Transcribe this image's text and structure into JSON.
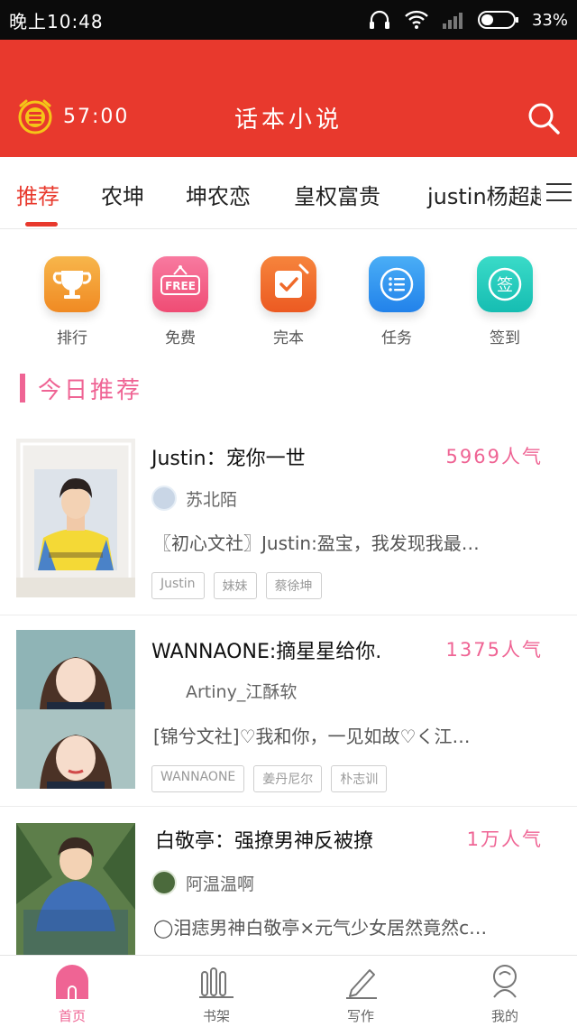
{
  "status_bar": {
    "time": "晚上10:48",
    "battery": "33%"
  },
  "header": {
    "timer": "57:00",
    "title": "话本小说"
  },
  "tabs": [
    {
      "label": "推荐",
      "active": true
    },
    {
      "label": "农坤",
      "active": false
    },
    {
      "label": "坤农恋",
      "active": false
    },
    {
      "label": "皇权富贵",
      "active": false
    },
    {
      "label": "justin杨超越",
      "active": false
    }
  ],
  "quick_links": [
    {
      "label": "排行",
      "icon": "trophy-icon",
      "color": "#f39a2e"
    },
    {
      "label": "免费",
      "icon": "free-tag-icon",
      "color": "#f2547c",
      "badge": "FREE"
    },
    {
      "label": "完本",
      "icon": "checkmark-icon",
      "color": "#f06a2a"
    },
    {
      "label": "任务",
      "icon": "list-icon",
      "color": "#2f92f0"
    },
    {
      "label": "签到",
      "icon": "sign-in-icon",
      "color": "#22c9c0",
      "badge": "签"
    }
  ],
  "section": {
    "title": "今日推荐"
  },
  "books": [
    {
      "title": "Justin：宠你一世",
      "popularity": "5969人气",
      "author": "苏北陌",
      "description": "〖初心文社〗Justin:盈宝，我发现我最…",
      "tags": [
        "Justin",
        "妹妹",
        "蔡徐坤"
      ]
    },
    {
      "title": "WANNAONE:摘星星给你.",
      "popularity": "1375人气",
      "author": "Artiny_江酥软",
      "description": "[锦兮文社]♡我和你，一见如故♡く江…",
      "tags": [
        "WANNAONE",
        "姜丹尼尔",
        "朴志训"
      ]
    },
    {
      "title": "白敬亭：强撩男神反被撩",
      "popularity": "1万人气",
      "author": "阿温温啊",
      "description": "◯泪痣男神白敬亭×元气少女居然竟然c…",
      "tags": []
    }
  ],
  "bottom_nav": [
    {
      "label": "首页",
      "icon": "home-icon",
      "active": true
    },
    {
      "label": "书架",
      "icon": "bookshelf-icon",
      "active": false
    },
    {
      "label": "写作",
      "icon": "pen-icon",
      "active": false
    },
    {
      "label": "我的",
      "icon": "profile-icon",
      "active": false
    }
  ],
  "colors": {
    "header_red": "#e8392d",
    "accent_pink": "#ef6494"
  }
}
